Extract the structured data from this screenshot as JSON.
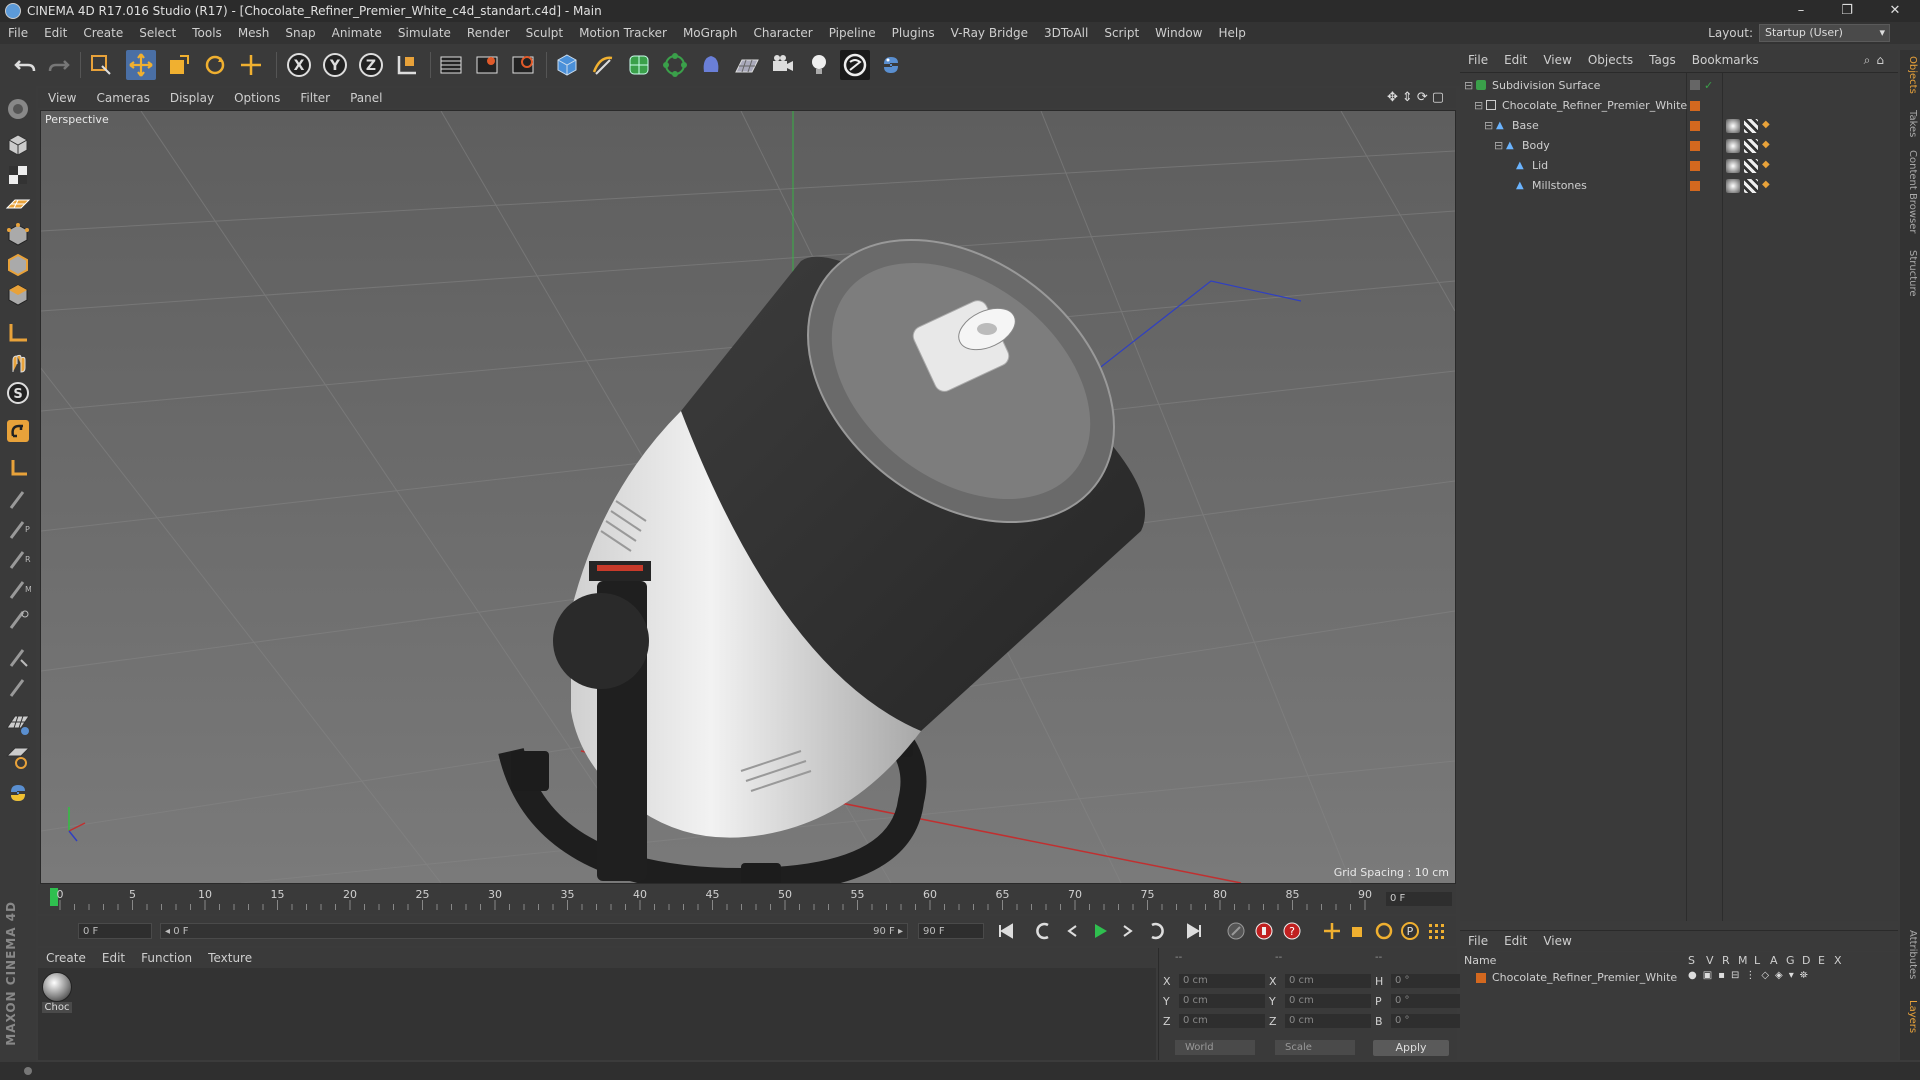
{
  "window": {
    "title": "CINEMA 4D R17.016 Studio (R17) - [Chocolate_Refiner_Premier_White_c4d_standart.c4d] - Main",
    "minimize": "–",
    "restore": "❐",
    "close": "✕"
  },
  "menu": [
    "File",
    "Edit",
    "Create",
    "Select",
    "Tools",
    "Mesh",
    "Snap",
    "Animate",
    "Simulate",
    "Render",
    "Sculpt",
    "Motion Tracker",
    "MoGraph",
    "Character",
    "Pipeline",
    "Plugins",
    "V-Ray Bridge",
    "3DToAll",
    "Script",
    "Window",
    "Help"
  ],
  "layout": {
    "label": "Layout:",
    "value": "Startup (User)"
  },
  "toolbar_icons": [
    "undo-icon",
    "redo-icon",
    "live-select-icon",
    "move-icon",
    "scale-icon",
    "rotate-icon",
    "transform-icon",
    "lock-x-icon",
    "lock-y-icon",
    "lock-z-icon",
    "world-coords-icon",
    "render-view-icon",
    "render-picture-viewer-icon",
    "edit-render-settings-icon",
    "cube-icon",
    "pen-icon",
    "subdivision-icon",
    "array-icon",
    "deformer-icon",
    "floor-icon",
    "camera-icon",
    "light-icon",
    "vray-icon",
    "python-icon"
  ],
  "viewport": {
    "menu": [
      "View",
      "Cameras",
      "Display",
      "Options",
      "Filter",
      "Panel"
    ],
    "label": "Perspective",
    "grid_spacing": "Grid Spacing : 10 cm"
  },
  "timeline": {
    "ticks": [
      "0",
      "5",
      "10",
      "15",
      "20",
      "25",
      "30",
      "35",
      "40",
      "45",
      "50",
      "55",
      "60",
      "65",
      "70",
      "75",
      "80",
      "85",
      "90"
    ],
    "end_field": "0 F"
  },
  "transport": {
    "start_field": "0 F",
    "range_left": "◂ 0 F",
    "range_right": "90 F ▸",
    "end_field": "90 F"
  },
  "material_manager": {
    "menu": [
      "Create",
      "Edit",
      "Function",
      "Texture"
    ],
    "material_name": "Choc"
  },
  "coordinates": {
    "col_headers": [
      "--",
      "--",
      "--"
    ],
    "rows": [
      {
        "a": "X",
        "v1": "0 cm",
        "b": "X",
        "v2": "0 cm",
        "c": "H",
        "v3": "0 °"
      },
      {
        "a": "Y",
        "v1": "0 cm",
        "b": "Y",
        "v2": "0 cm",
        "c": "P",
        "v3": "0 °"
      },
      {
        "a": "Z",
        "v1": "0 cm",
        "b": "Z",
        "v2": "0 cm",
        "c": "B",
        "v3": "0 °"
      }
    ],
    "mode": "World",
    "transform": "Scale",
    "apply": "Apply"
  },
  "object_manager": {
    "menu": [
      "File",
      "Edit",
      "View",
      "Objects",
      "Tags",
      "Bookmarks"
    ],
    "objects": [
      {
        "name": "Subdivision Surface",
        "indent": 0,
        "icon": "subdivision-surface-icon"
      },
      {
        "name": "Chocolate_Refiner_Premier_White",
        "indent": 1,
        "icon": "null-object-icon"
      },
      {
        "name": "Base",
        "indent": 2,
        "icon": "polygon-object-icon"
      },
      {
        "name": "Body",
        "indent": 3,
        "icon": "polygon-object-icon"
      },
      {
        "name": "Lid",
        "indent": 4,
        "icon": "polygon-object-icon"
      },
      {
        "name": "Millstones",
        "indent": 4,
        "icon": "polygon-object-icon"
      }
    ]
  },
  "layer_manager": {
    "menu": [
      "File",
      "Edit",
      "View"
    ],
    "columns": [
      "Name",
      "S",
      "V",
      "R",
      "M",
      "L",
      "A",
      "G",
      "D",
      "E",
      "X"
    ],
    "layer_name": "Chocolate_Refiner_Premier_White",
    "layer_color": "#d3681f"
  },
  "right_tabs": [
    "Objects",
    "Takes",
    "Content Browser",
    "Structure",
    "Attributes",
    "Layers"
  ],
  "left_logo": "MAXON CINEMA 4D",
  "colors": {
    "accent_orange": "#d3681f",
    "active_tool": "#4a6fa5",
    "viewport_bg": "#6a6a6a"
  }
}
